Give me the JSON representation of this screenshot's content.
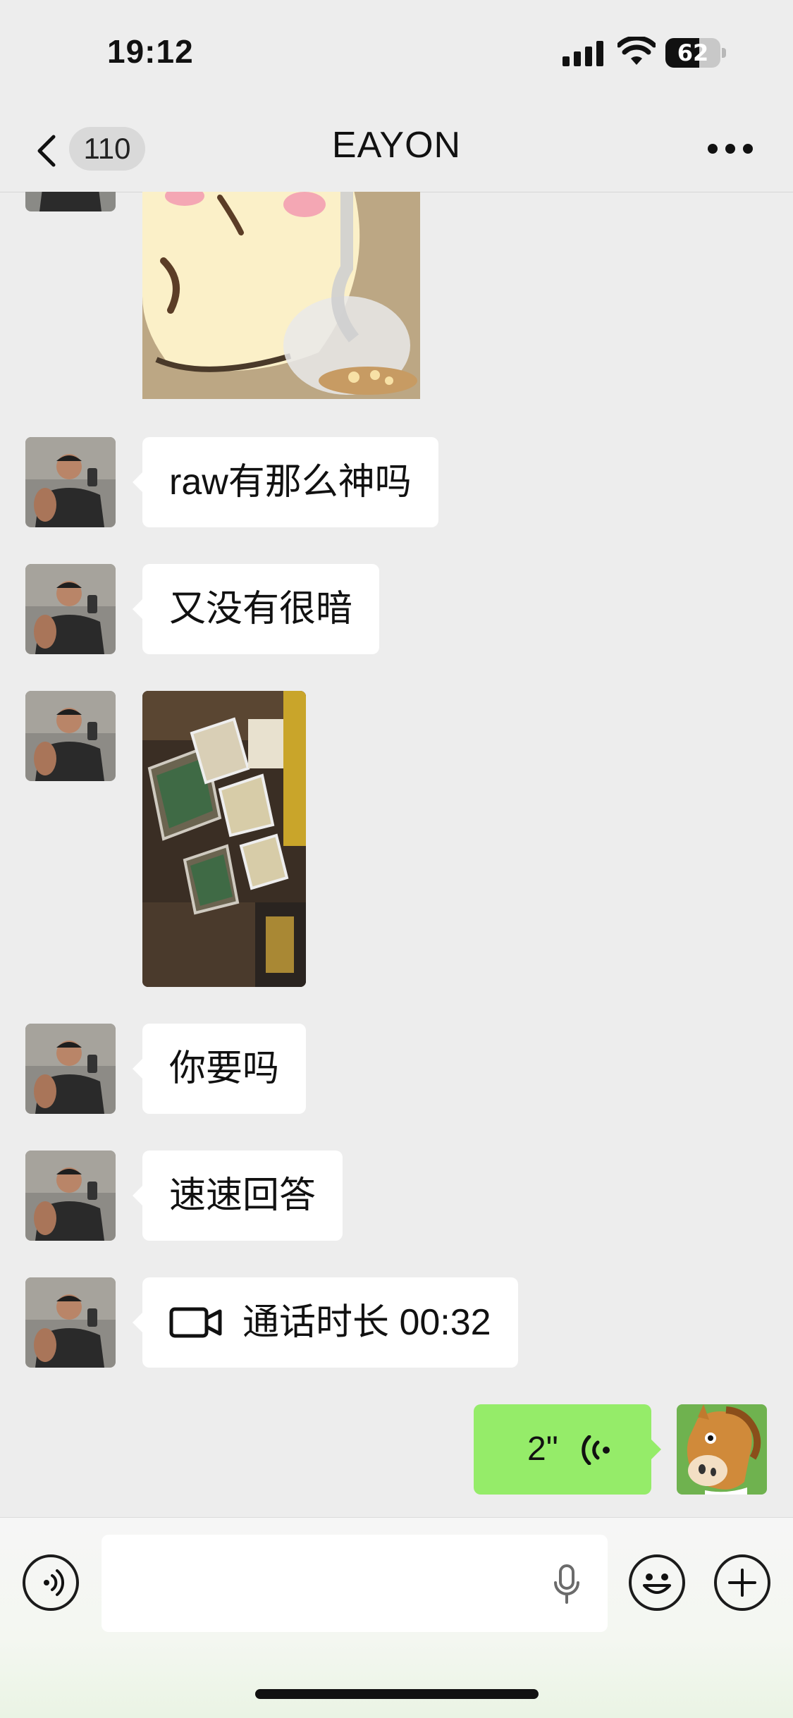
{
  "status_bar": {
    "time": "19:12",
    "battery_level": "62",
    "battery_fraction": 0.62
  },
  "nav": {
    "back_count": "110",
    "title": "EAYON"
  },
  "messages": [
    {
      "type": "sticker",
      "sender": "contact"
    },
    {
      "type": "text",
      "sender": "contact",
      "text": "raw有那么神吗"
    },
    {
      "type": "text",
      "sender": "contact",
      "text": "又没有很暗"
    },
    {
      "type": "image",
      "sender": "contact"
    },
    {
      "type": "text",
      "sender": "contact",
      "text": "你要吗"
    },
    {
      "type": "text",
      "sender": "contact",
      "text": "速速回答"
    },
    {
      "type": "video_call",
      "sender": "contact",
      "text": "通话时长 00:32"
    },
    {
      "type": "voice",
      "sender": "me",
      "duration": "2\""
    }
  ],
  "input_bar": {
    "placeholder": ""
  },
  "icons": {
    "back": "chevron-left-icon",
    "more": "more-dots-icon",
    "voice_toggle": "voice-toggle-icon",
    "mic": "microphone-icon",
    "emoji": "emoji-icon",
    "plus": "plus-icon",
    "video_call": "video-camera-icon"
  },
  "colors": {
    "background": "#ededed",
    "my_bubble": "#95ec69",
    "contact_bubble": "#ffffff"
  }
}
